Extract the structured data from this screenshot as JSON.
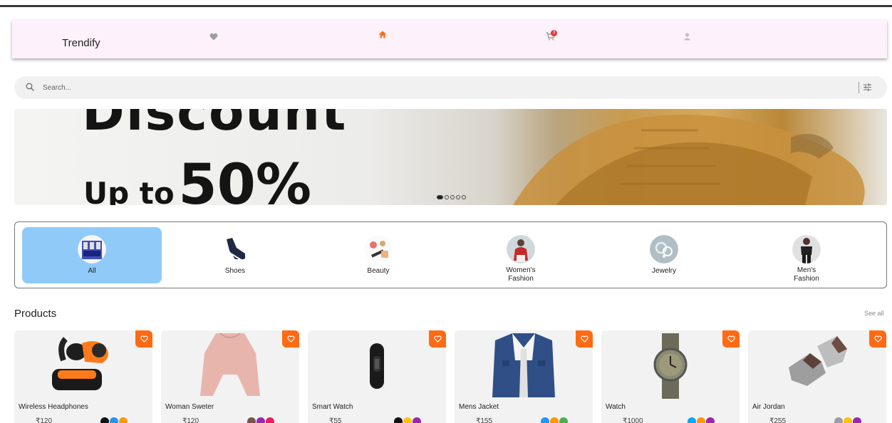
{
  "app": {
    "brand": "Trendify"
  },
  "nav": {
    "cart_count": "3",
    "icons": [
      "heart-icon",
      "home-icon",
      "cart-icon",
      "user-icon"
    ],
    "accent": "#ff6a13"
  },
  "search": {
    "placeholder": "Search..."
  },
  "banner": {
    "headline": "Discount",
    "sub_prefix": "Up to",
    "sub_value": "50%",
    "slide_count": 5,
    "active_slide": 1
  },
  "categories": [
    {
      "label": "All",
      "active": true
    },
    {
      "label": "Shoes",
      "active": false
    },
    {
      "label": "Beauty",
      "active": false
    },
    {
      "label": "Women's Fashion",
      "active": false
    },
    {
      "label": "Jewelry",
      "active": false
    },
    {
      "label": "Men's Fashion",
      "active": false
    }
  ],
  "products_section": {
    "title": "Products",
    "see_all": "See all"
  },
  "products": [
    {
      "name": "Wireless Headphones",
      "price": "₹120",
      "colors": [
        "#111111",
        "#2196f3",
        "#ff9800"
      ]
    },
    {
      "name": "Woman Sweter",
      "price": "₹120",
      "colors": [
        "#795548",
        "#9c27b0",
        "#e91e63"
      ]
    },
    {
      "name": "Smart Watch",
      "price": "₹55",
      "colors": [
        "#111111",
        "#ffc107",
        "#9c27b0"
      ]
    },
    {
      "name": "Mens Jacket",
      "price": "₹155",
      "colors": [
        "#2196f3",
        "#ff9800",
        "#4caf50"
      ]
    },
    {
      "name": "Watch",
      "price": "₹1000",
      "colors": [
        "#03a9f4",
        "#ff9800",
        "#9c27b0"
      ]
    },
    {
      "name": "Air Jordan",
      "price": "₹255",
      "colors": [
        "#9e9e9e",
        "#ffc107",
        "#9c27b0"
      ]
    }
  ]
}
